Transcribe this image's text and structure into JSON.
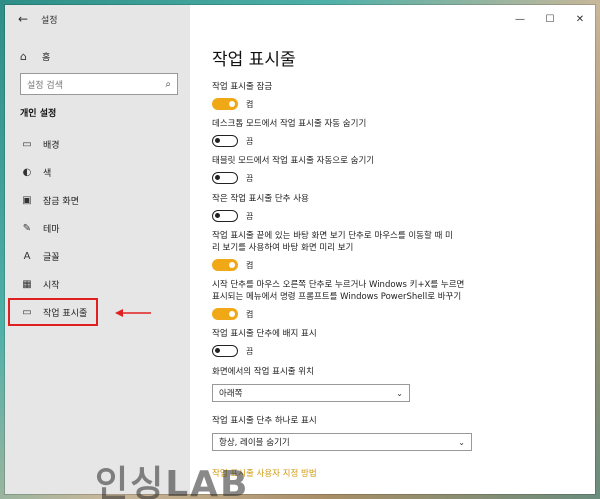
{
  "app": {
    "title": "설정"
  },
  "sidebar": {
    "home_label": "홈",
    "search_placeholder": "설정 검색",
    "section_title": "개인 설정",
    "items": [
      {
        "label": "배경",
        "icon": "image-icon"
      },
      {
        "label": "색",
        "icon": "palette-icon"
      },
      {
        "label": "잠금 화면",
        "icon": "lock-screen-icon"
      },
      {
        "label": "테마",
        "icon": "brush-icon"
      },
      {
        "label": "글꼴",
        "icon": "font-icon"
      },
      {
        "label": "시작",
        "icon": "start-icon"
      },
      {
        "label": "작업 표시줄",
        "icon": "taskbar-icon",
        "active": true
      }
    ]
  },
  "main": {
    "title": "작업 표시줄",
    "settings": [
      {
        "title": "작업 표시줄 잠금",
        "state": "켬",
        "on": true
      },
      {
        "title": "데스크톱 모드에서 작업 표시줄 자동 숨기기",
        "state": "끔",
        "on": false
      },
      {
        "title": "태블릿 모드에서 작업 표시줄 자동으로 숨기기",
        "state": "끔",
        "on": false
      },
      {
        "title": "작은 작업 표시줄 단추 사용",
        "state": "끔",
        "on": false
      },
      {
        "title_line1": "작업 표시줄 끝에 있는 바탕 화면 보기 단추로 마우스를 이동할 때 미",
        "title_line2": "리 보기를 사용하여 바탕 화면 미리 보기",
        "state": "켬",
        "on": true
      },
      {
        "title_line1": "시작 단추를 마우스 오른쪽 단추로 누르거나 Windows 키+X를 누르면",
        "title_line2": "표시되는 메뉴에서 명령 프롬프트를 Windows PowerShell로 바꾸기",
        "state": "켬",
        "on": true
      },
      {
        "title": "작업 표시줄 단추에 배지 표시",
        "state": "끔",
        "on": false
      }
    ],
    "location": {
      "title": "화면에서의 작업 표시줄 위치",
      "value": "아래쪽"
    },
    "combine": {
      "title": "작업 표시줄 단추 하나로 표시",
      "value": "항상, 레이블 숨기기"
    },
    "link": "작업 표시줄 사용자 지정 방법"
  },
  "watermark": "인싱LAB",
  "colors": {
    "accent": "#f0a817",
    "highlight": "#e02020"
  }
}
